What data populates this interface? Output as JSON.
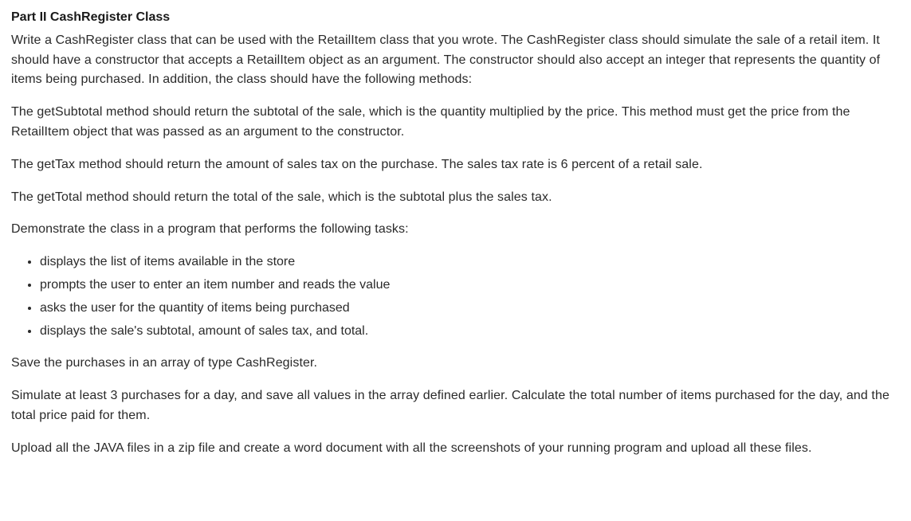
{
  "heading": "Part II CashRegister Class",
  "paragraphs": {
    "intro": "Write a CashRegister class that can be used with the RetailItem class that you wrote. The CashRegister class should simulate the sale of a retail item. It should have a constructor that accepts a RetailItem object as an argument. The constructor should also accept an integer that represents the quantity of items being purchased. In addition, the class should have the following methods:",
    "getSubtotal": "The getSubtotal method should return the subtotal of the sale, which is the quantity multiplied by the price. This method must get the price from the RetailItem object that was passed as an argument to the constructor.",
    "getTax": "The getTax method should return the amount of sales tax on the purchase. The sales tax rate is 6 percent of a retail sale.",
    "getTotal": "The getTotal method should return the total of the sale, which is the subtotal plus the sales tax.",
    "demoIntro": "Demonstrate the class in a program that performs the following tasks:",
    "saveArray": "Save the purchases in an array of type CashRegister.",
    "simulate": "Simulate at least 3 purchases for a day, and save all values in the array defined earlier. Calculate the total number of items purchased for the day, and the total price paid for them.",
    "upload": "Upload all the JAVA files in a zip file and create a word document with all the screenshots of your running program and upload all these files."
  },
  "bullets": [
    "displays the list of items available in the store",
    "prompts the user to enter an item number and reads the value",
    "asks the user for the quantity of items being purchased",
    "displays the sale's subtotal, amount of sales tax, and total."
  ]
}
